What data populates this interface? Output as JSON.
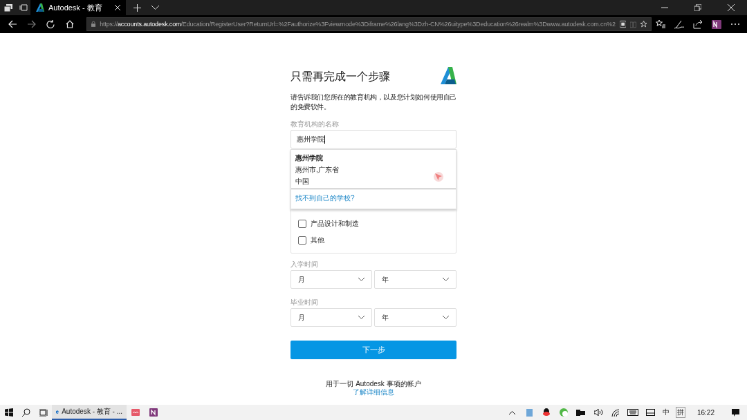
{
  "browser": {
    "tabs": [
      {
        "title": "Autodesk - 教育",
        "selected": true
      }
    ],
    "url": "https://**accounts.autodesk.com**/Education/RegisterUser?ReturnUrl=%2Fauthorize%3Fviewmode%3Diframe%26lang%3Dzh-CN%26uitype%3Deducation%26realm%3Dwww.autodesk.com.cn%2"
  },
  "form": {
    "title": "只需再完成一个步骤",
    "description": "请告诉我们您所在的教育机构，以及您计划如何使用自己的免费软件。",
    "institution": {
      "label": "教育机构的名称",
      "value": "惠州学院"
    },
    "suggestion": {
      "name": "惠州学院",
      "city": "惠州市,广东省",
      "country": "中国"
    },
    "not_found_link": "找不到自己的学校?",
    "checkboxes": [
      {
        "label": "产品设计和制造",
        "checked": false
      },
      {
        "label": "其他",
        "checked": false
      }
    ],
    "dates": [
      {
        "label": "入学时间",
        "month": "月",
        "year": "年"
      },
      {
        "label": "毕业时间",
        "month": "月",
        "year": "年"
      }
    ],
    "next_button": "下一步",
    "footer": {
      "text": "用于一切 Autodesk 事项的帐户",
      "link": "了解详细信息"
    }
  },
  "taskbar": {
    "apps": [
      {
        "kind": "browser",
        "title": "Autodesk - 教育 - ...",
        "selected": true
      },
      {
        "kind": "music",
        "selected": false
      },
      {
        "kind": "notes",
        "selected": false
      }
    ],
    "ime": "中",
    "ime_mode": "拼",
    "clock": "16:22"
  }
}
